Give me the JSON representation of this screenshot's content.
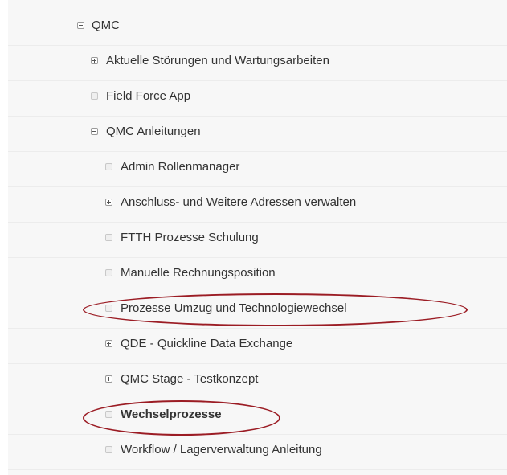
{
  "tree": {
    "root": {
      "label": "QMC",
      "state": "expanded",
      "icon": "minus-icon"
    },
    "level1": [
      {
        "label": "Aktuelle Störungen und Wartungsarbeiten",
        "state": "collapsed",
        "icon": "plus-icon"
      },
      {
        "label": "Field Force App",
        "state": "leaf",
        "icon": "leaf-icon"
      },
      {
        "label": "QMC Anleitungen",
        "state": "expanded",
        "icon": "minus-icon"
      }
    ],
    "anleitungen_children": [
      {
        "label": "Admin Rollenmanager",
        "state": "leaf",
        "icon": "leaf-icon"
      },
      {
        "label": "Anschluss- und Weitere Adressen verwalten",
        "state": "collapsed",
        "icon": "plus-icon"
      },
      {
        "label": "FTTH Prozesse Schulung",
        "state": "leaf",
        "icon": "leaf-icon"
      },
      {
        "label": "Manuelle Rechnungsposition",
        "state": "leaf",
        "icon": "leaf-icon"
      },
      {
        "label": "Prozesse Umzug und Technologiewechsel",
        "state": "leaf",
        "icon": "leaf-icon",
        "highlighted": true
      },
      {
        "label": "QDE - Quickline Data Exchange",
        "state": "collapsed",
        "icon": "plus-icon"
      },
      {
        "label": "QMC Stage - Testkonzept",
        "state": "collapsed",
        "icon": "plus-icon"
      },
      {
        "label": "Wechselprozesse",
        "state": "leaf",
        "icon": "leaf-icon",
        "highlighted": true,
        "selected": true
      },
      {
        "label": "Workflow / Lagerverwaltung Anleitung",
        "state": "leaf",
        "icon": "leaf-icon"
      }
    ]
  },
  "colors": {
    "panel_background": "#f7f7f7",
    "text": "#333333",
    "annotation_ellipse": "#9b1c24"
  }
}
